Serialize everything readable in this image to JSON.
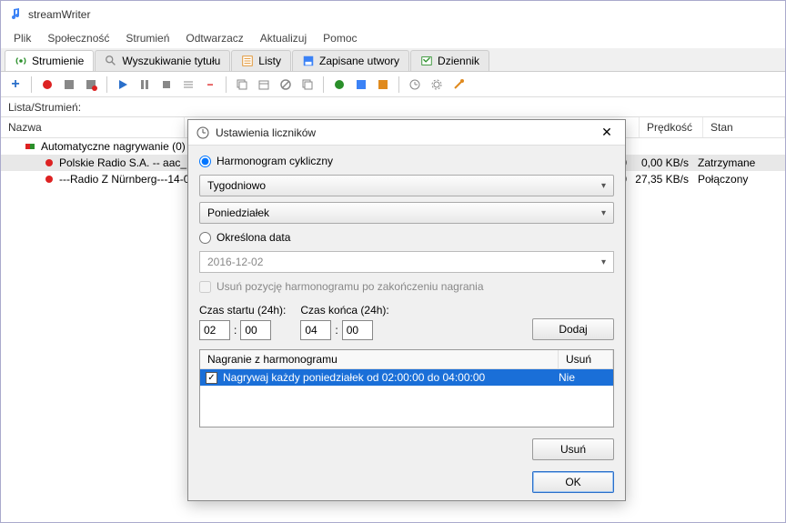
{
  "window": {
    "title": "streamWriter"
  },
  "menu": {
    "items": [
      "Plik",
      "Społeczność",
      "Strumień",
      "Odtwarzacz",
      "Aktualizuj",
      "Pomoc"
    ]
  },
  "tabs": {
    "items": [
      "Strumienie",
      "Wyszukiwanie tytułu",
      "Listy",
      "Zapisane utwory",
      "Dziennik"
    ],
    "active": 0
  },
  "list_header": "Lista/Strumień:",
  "columns": {
    "name": "Nazwa",
    "speed": "Prędkość",
    "state": "Stan"
  },
  "tree": {
    "group": "Automatyczne nagrywanie (0)",
    "rows": [
      {
        "label": "Polskie Radio S.A. -- aac_Re…",
        "num": "0",
        "speed": "0,00 KB/s",
        "state": "Zatrzymane",
        "selected": true,
        "rec": false
      },
      {
        "label": "---Radio Z Nürnberg---14-02 …",
        "num": "0",
        "speed": "27,35 KB/s",
        "state": "Połączony",
        "selected": false,
        "rec": true
      }
    ]
  },
  "dialog": {
    "title": "Ustawienia liczników",
    "radio_cyclic": "Harmonogram cykliczny",
    "combo_period": "Tygodniowo",
    "combo_day": "Poniedziałek",
    "radio_date": "Określona data",
    "date_value": "2016-12-02",
    "check_remove": "Usuń pozycję harmonogramu po zakończeniu nagrania",
    "start_label": "Czas startu (24h):",
    "end_label": "Czas końca (24h):",
    "start_h": "02",
    "start_m": "00",
    "end_h": "04",
    "end_m": "00",
    "add_btn": "Dodaj",
    "table_head_desc": "Nagranie z harmonogramu",
    "table_head_del": "Usuń",
    "row_desc": "Nagrywaj każdy poniedziałek od 02:00:00 do 04:00:00",
    "row_del": "Nie",
    "remove_btn": "Usuń",
    "ok_btn": "OK"
  }
}
